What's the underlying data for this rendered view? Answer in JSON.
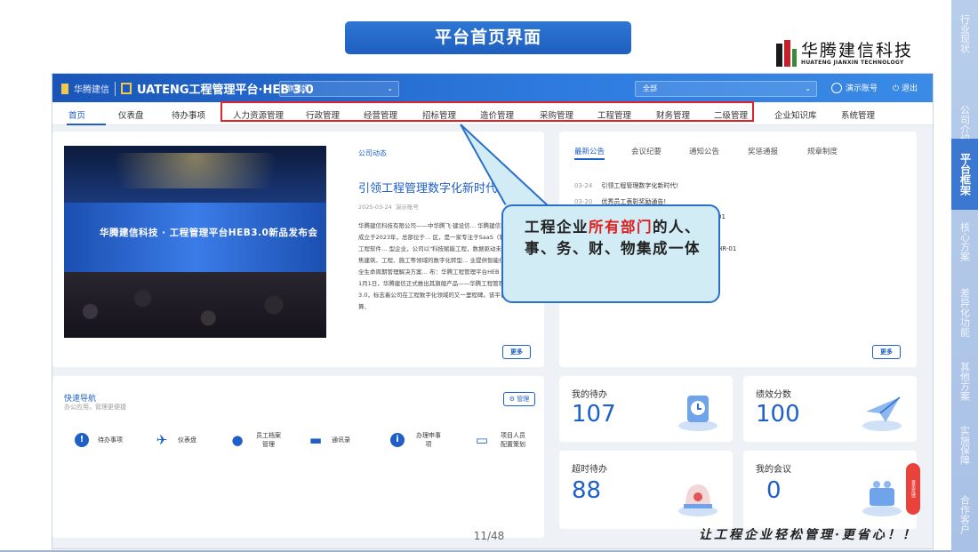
{
  "slide": {
    "title": "平台首页界面",
    "page_number": "11/48",
    "slogan": "让工程企业轻松管理·更省心！！",
    "logo": {
      "cn": "华腾建信科技",
      "en": "HUATENG JIANXIN TECHNOLOGY"
    },
    "right_nav": [
      "行业现状",
      "公司介绍",
      "平台框架",
      "核心方案",
      "差异化功能",
      "其他方案",
      "实施保障",
      "合作客户"
    ],
    "right_nav_active": 2,
    "callout": {
      "pre": "工程企业",
      "highlight": "所有部门",
      "post": "的人、事、务、财、物集成一体"
    }
  },
  "app": {
    "brand_small": "华腾建信",
    "brand": "UATENG工程管理平台·HEB 3.0",
    "edition_select": "旗舰版",
    "scope_select": "全部",
    "user": "演示账号",
    "logout": "退出",
    "menu": [
      "首页",
      "仪表盘",
      "待办事项",
      "人力资源管理",
      "行政管理",
      "经营管理",
      "招标管理",
      "造价管理",
      "采购管理",
      "工程管理",
      "财务管理",
      "二级管理",
      "企业知识库",
      "系统管理"
    ],
    "active_menu": 0
  },
  "news": {
    "section": "公司动态",
    "headline": "引领工程管理数字化新时代!",
    "date": "2025-03-24",
    "author": "演示账号",
    "body": "华腾建信科技有限公司——中华腾飞·建设信… 华腾建信科技有限公司成立于2023年，总部位于… 区，是一家专注于SaaS（软件即服务）工程软件… 型企业，公司以\"科技赋能工程，数据驱动未来\"… 念，聚焦建筑、工程、施工等领域的数字化转型… 业提供智能化、云端化的全生命周期管理解决方案… 布：华腾工程管理平台HEB 3.0 2025年1月1日，华腾建信正式推出其旗舰产品——华腾工程管理平台HEB 3.0，标志着公司在工程数字化领域的又一里程碑。该平台基于云计算、",
    "stage_text": "华腾建信科技 · 工程管理平台HEB3.0新品发布会",
    "more": "更多"
  },
  "announcements": {
    "tabs": [
      "最新公告",
      "会议纪要",
      "通知公告",
      "奖惩通报",
      "规章制度"
    ],
    "items": [
      {
        "date": "03-24",
        "text": "引领工程管理数字化新时代!"
      },
      {
        "date": "03-20",
        "text": "优秀员工表彰奖励通告!"
      },
      {
        "date": "",
        "text": "01"
      },
      {
        "date": "",
        "text": "HR-01"
      }
    ],
    "more": "更多"
  },
  "quick_nav": {
    "title": "快速导航",
    "subtitle": "办公应用，管理更便捷",
    "manage": "管理",
    "items": [
      "待办事项",
      "仪表盘",
      "员工档案管理",
      "通讯录",
      "办理申事项",
      "项目人员配置策划"
    ]
  },
  "kpis": [
    {
      "label": "我的待办",
      "value": "107"
    },
    {
      "label": "绩效分数",
      "value": "100"
    },
    {
      "label": "超时待办",
      "value": "88"
    },
    {
      "label": "我的会议",
      "value": "0"
    }
  ],
  "float_button": "意见反馈",
  "colors": {
    "brand_blue": "#1f5fc8",
    "highlight_red": "#e02020",
    "box_red": "#e0222a",
    "callout_bg": "#d2ecf5"
  }
}
